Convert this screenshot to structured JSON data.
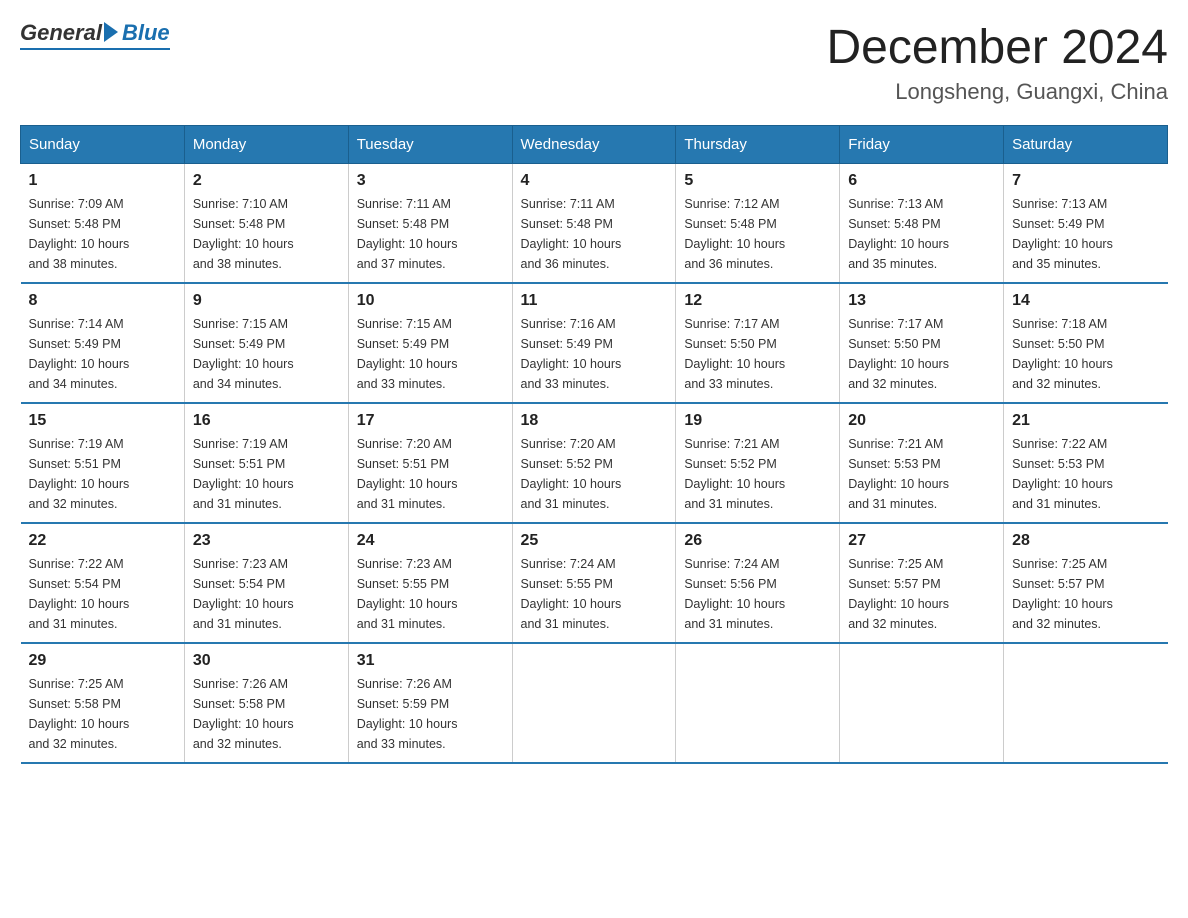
{
  "logo": {
    "general": "General",
    "blue": "Blue"
  },
  "title": "December 2024",
  "location": "Longsheng, Guangxi, China",
  "weekdays": [
    "Sunday",
    "Monday",
    "Tuesday",
    "Wednesday",
    "Thursday",
    "Friday",
    "Saturday"
  ],
  "weeks": [
    [
      {
        "day": "1",
        "sunrise": "7:09 AM",
        "sunset": "5:48 PM",
        "daylight": "10 hours and 38 minutes."
      },
      {
        "day": "2",
        "sunrise": "7:10 AM",
        "sunset": "5:48 PM",
        "daylight": "10 hours and 38 minutes."
      },
      {
        "day": "3",
        "sunrise": "7:11 AM",
        "sunset": "5:48 PM",
        "daylight": "10 hours and 37 minutes."
      },
      {
        "day": "4",
        "sunrise": "7:11 AM",
        "sunset": "5:48 PM",
        "daylight": "10 hours and 36 minutes."
      },
      {
        "day": "5",
        "sunrise": "7:12 AM",
        "sunset": "5:48 PM",
        "daylight": "10 hours and 36 minutes."
      },
      {
        "day": "6",
        "sunrise": "7:13 AM",
        "sunset": "5:48 PM",
        "daylight": "10 hours and 35 minutes."
      },
      {
        "day": "7",
        "sunrise": "7:13 AM",
        "sunset": "5:49 PM",
        "daylight": "10 hours and 35 minutes."
      }
    ],
    [
      {
        "day": "8",
        "sunrise": "7:14 AM",
        "sunset": "5:49 PM",
        "daylight": "10 hours and 34 minutes."
      },
      {
        "day": "9",
        "sunrise": "7:15 AM",
        "sunset": "5:49 PM",
        "daylight": "10 hours and 34 minutes."
      },
      {
        "day": "10",
        "sunrise": "7:15 AM",
        "sunset": "5:49 PM",
        "daylight": "10 hours and 33 minutes."
      },
      {
        "day": "11",
        "sunrise": "7:16 AM",
        "sunset": "5:49 PM",
        "daylight": "10 hours and 33 minutes."
      },
      {
        "day": "12",
        "sunrise": "7:17 AM",
        "sunset": "5:50 PM",
        "daylight": "10 hours and 33 minutes."
      },
      {
        "day": "13",
        "sunrise": "7:17 AM",
        "sunset": "5:50 PM",
        "daylight": "10 hours and 32 minutes."
      },
      {
        "day": "14",
        "sunrise": "7:18 AM",
        "sunset": "5:50 PM",
        "daylight": "10 hours and 32 minutes."
      }
    ],
    [
      {
        "day": "15",
        "sunrise": "7:19 AM",
        "sunset": "5:51 PM",
        "daylight": "10 hours and 32 minutes."
      },
      {
        "day": "16",
        "sunrise": "7:19 AM",
        "sunset": "5:51 PM",
        "daylight": "10 hours and 31 minutes."
      },
      {
        "day": "17",
        "sunrise": "7:20 AM",
        "sunset": "5:51 PM",
        "daylight": "10 hours and 31 minutes."
      },
      {
        "day": "18",
        "sunrise": "7:20 AM",
        "sunset": "5:52 PM",
        "daylight": "10 hours and 31 minutes."
      },
      {
        "day": "19",
        "sunrise": "7:21 AM",
        "sunset": "5:52 PM",
        "daylight": "10 hours and 31 minutes."
      },
      {
        "day": "20",
        "sunrise": "7:21 AM",
        "sunset": "5:53 PM",
        "daylight": "10 hours and 31 minutes."
      },
      {
        "day": "21",
        "sunrise": "7:22 AM",
        "sunset": "5:53 PM",
        "daylight": "10 hours and 31 minutes."
      }
    ],
    [
      {
        "day": "22",
        "sunrise": "7:22 AM",
        "sunset": "5:54 PM",
        "daylight": "10 hours and 31 minutes."
      },
      {
        "day": "23",
        "sunrise": "7:23 AM",
        "sunset": "5:54 PM",
        "daylight": "10 hours and 31 minutes."
      },
      {
        "day": "24",
        "sunrise": "7:23 AM",
        "sunset": "5:55 PM",
        "daylight": "10 hours and 31 minutes."
      },
      {
        "day": "25",
        "sunrise": "7:24 AM",
        "sunset": "5:55 PM",
        "daylight": "10 hours and 31 minutes."
      },
      {
        "day": "26",
        "sunrise": "7:24 AM",
        "sunset": "5:56 PM",
        "daylight": "10 hours and 31 minutes."
      },
      {
        "day": "27",
        "sunrise": "7:25 AM",
        "sunset": "5:57 PM",
        "daylight": "10 hours and 32 minutes."
      },
      {
        "day": "28",
        "sunrise": "7:25 AM",
        "sunset": "5:57 PM",
        "daylight": "10 hours and 32 minutes."
      }
    ],
    [
      {
        "day": "29",
        "sunrise": "7:25 AM",
        "sunset": "5:58 PM",
        "daylight": "10 hours and 32 minutes."
      },
      {
        "day": "30",
        "sunrise": "7:26 AM",
        "sunset": "5:58 PM",
        "daylight": "10 hours and 32 minutes."
      },
      {
        "day": "31",
        "sunrise": "7:26 AM",
        "sunset": "5:59 PM",
        "daylight": "10 hours and 33 minutes."
      },
      null,
      null,
      null,
      null
    ]
  ]
}
